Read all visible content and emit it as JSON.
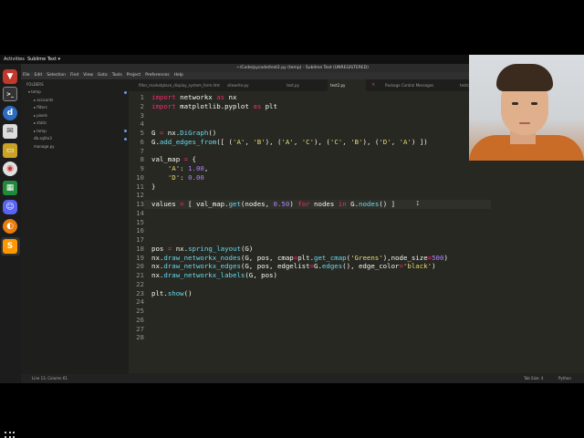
{
  "topbar": {
    "activities": "Activities",
    "app_menu": "Sublime Text ▾"
  },
  "window": {
    "title": "~/Code/pycode/test2.py (temp) - Sublime Text (UNREGISTERED)"
  },
  "menu": [
    "File",
    "Edit",
    "Selection",
    "Find",
    "View",
    "Goto",
    "Tools",
    "Project",
    "Preferences",
    "Help"
  ],
  "sidebar": {
    "header": "FOLDERS",
    "items": [
      {
        "label": "▾ temp",
        "indent": 0
      },
      {
        "label": "▸ accounts",
        "indent": 1
      },
      {
        "label": "▸ filters",
        "indent": 1
      },
      {
        "label": "▸ pixels",
        "indent": 1
      },
      {
        "label": "▸ static",
        "indent": 1
      },
      {
        "label": "▸ temp",
        "indent": 1
      },
      {
        "label": "db.sqlite3",
        "indent": 1
      },
      {
        "label": "manage.py",
        "indent": 1
      }
    ]
  },
  "tabs": [
    {
      "label": "filter_marketplace_display_system_form.html"
    },
    {
      "label": "sitewrite.py"
    },
    {
      "label": "test.py"
    },
    {
      "label": "test2.py",
      "active": true
    },
    {
      "label": "×"
    },
    {
      "label": "Package Control Messages"
    },
    {
      "label": "tests.txt"
    }
  ],
  "code_lines": [
    "import networkx as nx",
    "import matplotlib.pyplot as plt",
    "",
    "",
    "G = nx.DiGraph()",
    "G.add_edges_from([ ('A', 'B'), ('A', 'C'), ('C', 'B'), ('D', 'A') ])",
    "",
    "val_map = {",
    "    'A': 1.00,",
    "    'D': 0.00",
    "}",
    "",
    "values = [ val_map.get(nodes, 0.50) for nodes in G.nodes() ]",
    "",
    "",
    "",
    "",
    "pos = nx.spring_layout(G)",
    "nx.draw_networkx_nodes(G, pos, cmap=plt.get_cmap('Greens'),node_size=500)",
    "nx.draw_networkx_edges(G, pos, edgelist=G.edges(), edge_color='black')",
    "nx.draw_networkx_labels(G, pos)",
    "",
    "plt.show()",
    "",
    "",
    "",
    "",
    ""
  ],
  "status": {
    "position": "Line 13, Column 61",
    "tab_size": "Tab Size: 4",
    "syntax": "Python"
  },
  "colors": {
    "editor_bg": "#272822",
    "keyword": "#f92672",
    "function": "#66d9ef",
    "string": "#e6db74",
    "number": "#ae81ff"
  },
  "dock_icons": [
    "terminal-icon",
    "brave-icon",
    "d-app-icon",
    "mail-icon",
    "files-icon",
    "circle-app-icon",
    "spreadsheet-icon",
    "discord-icon",
    "blender-icon",
    "sublime-icon"
  ]
}
